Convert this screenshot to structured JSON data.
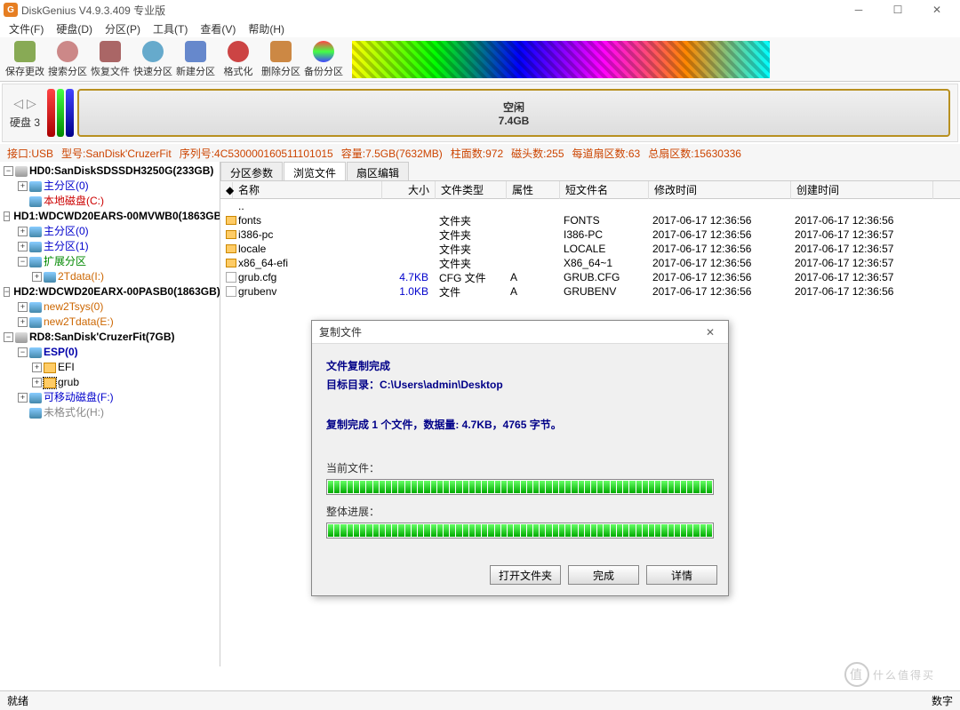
{
  "window": {
    "title": "DiskGenius V4.9.3.409 专业版",
    "icon_letter": "G"
  },
  "menu": [
    "文件(F)",
    "硬盘(D)",
    "分区(P)",
    "工具(T)",
    "查看(V)",
    "帮助(H)"
  ],
  "toolbar": [
    "保存更改",
    "搜索分区",
    "恢复文件",
    "快速分区",
    "新建分区",
    "格式化",
    "删除分区",
    "备份分区"
  ],
  "diskbar": {
    "label": "硬盘 3",
    "free_label": "空闲",
    "free_size": "7.4GB"
  },
  "infobar": {
    "iface_k": "接口:",
    "iface_v": "USB",
    "model_k": "型号:",
    "model_v": "SanDisk'CruzerFit",
    "serial_k": "序列号:",
    "serial_v": "4C530000160511101015",
    "cap_k": "容量:",
    "cap_v": "7.5GB(7632MB)",
    "cyl_k": "柱面数:",
    "cyl_v": "972",
    "head_k": "磁头数:",
    "head_v": "255",
    "spt_k": "每道扇区数:",
    "spt_v": "63",
    "total_k": "总扇区数:",
    "total_v": "15630336"
  },
  "tree": {
    "hd0": "HD0:SanDiskSDSSDH3250G(233GB)",
    "hd0_p0": "主分区(0)",
    "hd0_c": "本地磁盘(C:)",
    "hd1": "HD1:WDCWD20EARS-00MVWB0(1863GB)",
    "hd1_p0": "主分区(0)",
    "hd1_p1": "主分区(1)",
    "hd1_ext": "扩展分区",
    "hd1_2t": "2Tdata(I:)",
    "hd2": "HD2:WDCWD20EARX-00PASB0(1863GB)",
    "hd2_sys": "new2Tsys(0)",
    "hd2_data": "new2Tdata(E:)",
    "rd8": "RD8:SanDisk'CruzerFit(7GB)",
    "rd8_esp": "ESP(0)",
    "rd8_efi": "EFI",
    "rd8_grub": "grub",
    "rd8_f": "可移动磁盘(F:)",
    "rd8_un": "未格式化(H:)"
  },
  "tabs": [
    "分区参数",
    "浏览文件",
    "扇区编辑"
  ],
  "columns": {
    "name": "名称",
    "size": "大小",
    "type": "文件类型",
    "attr": "属性",
    "short": "短文件名",
    "mtime": "修改时间",
    "ctime": "创建时间"
  },
  "files": [
    {
      "icon": "up",
      "name": "..",
      "size": "",
      "type": "",
      "attr": "",
      "short": "",
      "mtime": "",
      "ctime": ""
    },
    {
      "icon": "dir",
      "name": "fonts",
      "size": "",
      "type": "文件夹",
      "attr": "",
      "short": "FONTS",
      "mtime": "2017-06-17 12:36:56",
      "ctime": "2017-06-17 12:36:56"
    },
    {
      "icon": "dir",
      "name": "i386-pc",
      "size": "",
      "type": "文件夹",
      "attr": "",
      "short": "I386-PC",
      "mtime": "2017-06-17 12:36:56",
      "ctime": "2017-06-17 12:36:57"
    },
    {
      "icon": "dir",
      "name": "locale",
      "size": "",
      "type": "文件夹",
      "attr": "",
      "short": "LOCALE",
      "mtime": "2017-06-17 12:36:56",
      "ctime": "2017-06-17 12:36:57"
    },
    {
      "icon": "dir",
      "name": "x86_64-efi",
      "size": "",
      "type": "文件夹",
      "attr": "",
      "short": "X86_64~1",
      "mtime": "2017-06-17 12:36:56",
      "ctime": "2017-06-17 12:36:57"
    },
    {
      "icon": "file",
      "name": "grub.cfg",
      "size": "4.7KB",
      "type": "CFG 文件",
      "attr": "A",
      "short": "GRUB.CFG",
      "mtime": "2017-06-17 12:36:56",
      "ctime": "2017-06-17 12:36:57"
    },
    {
      "icon": "file",
      "name": "grubenv",
      "size": "1.0KB",
      "type": "文件",
      "attr": "A",
      "short": "GRUBENV",
      "mtime": "2017-06-17 12:36:56",
      "ctime": "2017-06-17 12:36:56"
    }
  ],
  "dialog": {
    "title": "复制文件",
    "done": "文件复制完成",
    "target": "目标目录：C:\\Users\\admin\\Desktop",
    "summary": "复制完成 1 个文件，数据量: 4.7KB，4765 字节。",
    "current": "当前文件：",
    "overall": "整体进展：",
    "btn_open": "打开文件夹",
    "btn_done": "完成",
    "btn_detail": "详情"
  },
  "status": {
    "left": "就绪",
    "right": "数字"
  },
  "watermark": "什么值得买"
}
